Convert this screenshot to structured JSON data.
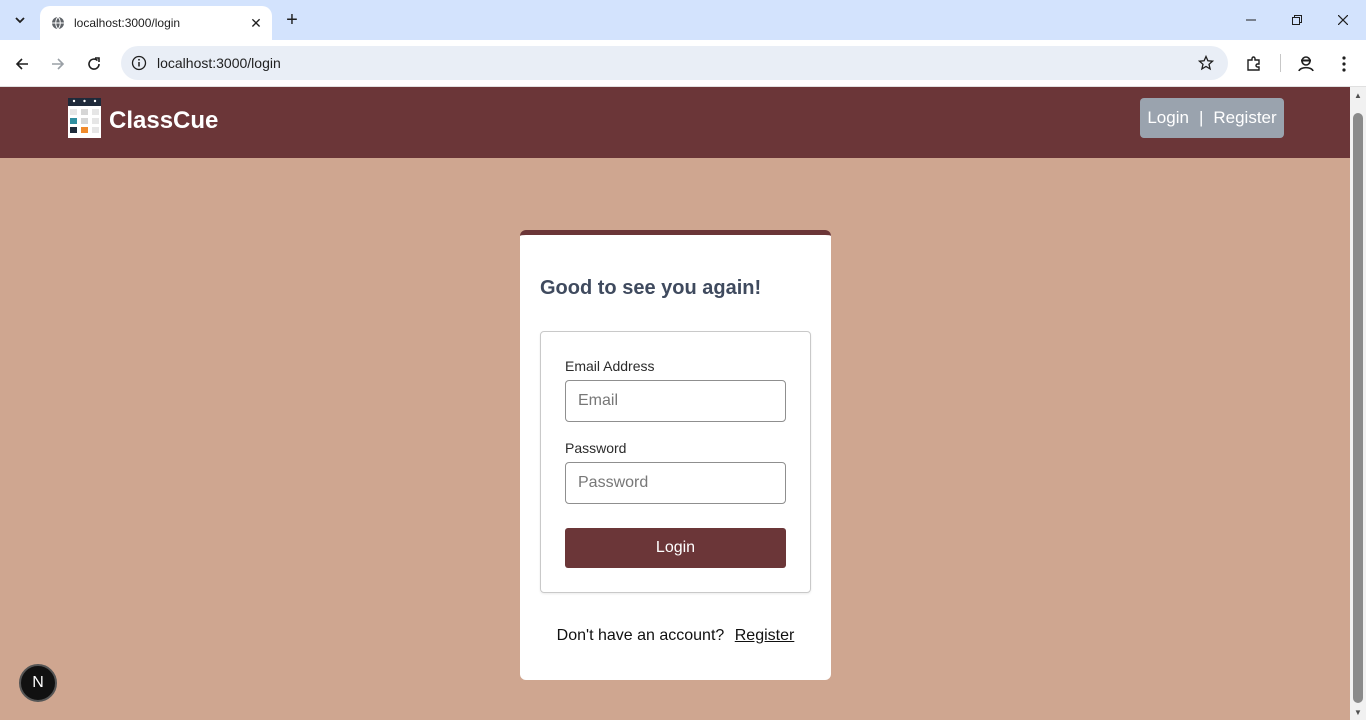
{
  "browser": {
    "tab_title": "localhost:3000/login",
    "url": "localhost:3000/login",
    "icons": [
      "tab-list-icon",
      "globe-icon",
      "close-icon",
      "plus-icon",
      "minimize-icon",
      "restore-icon",
      "window-close-icon",
      "back-icon",
      "forward-icon",
      "reload-icon",
      "site-info-icon",
      "bookmark-star-icon",
      "extensions-icon",
      "profile-icon",
      "menu-icon"
    ]
  },
  "header": {
    "brand": "ClassCue",
    "login_link": "Login",
    "separator": "|",
    "register_link": "Register",
    "bg_color": "#6b3638"
  },
  "login_card": {
    "title": "Good to see you again!",
    "email_label": "Email Address",
    "email_placeholder": "Email",
    "password_label": "Password",
    "password_placeholder": "Password",
    "submit_label": "Login",
    "no_account_text": "Don't have an account?",
    "register_link": "Register"
  },
  "dev_badge": {
    "label": "N"
  },
  "colors": {
    "page_bg": "#cfa690",
    "accent": "#6b3638",
    "auth_box": "#9aa3ae"
  }
}
